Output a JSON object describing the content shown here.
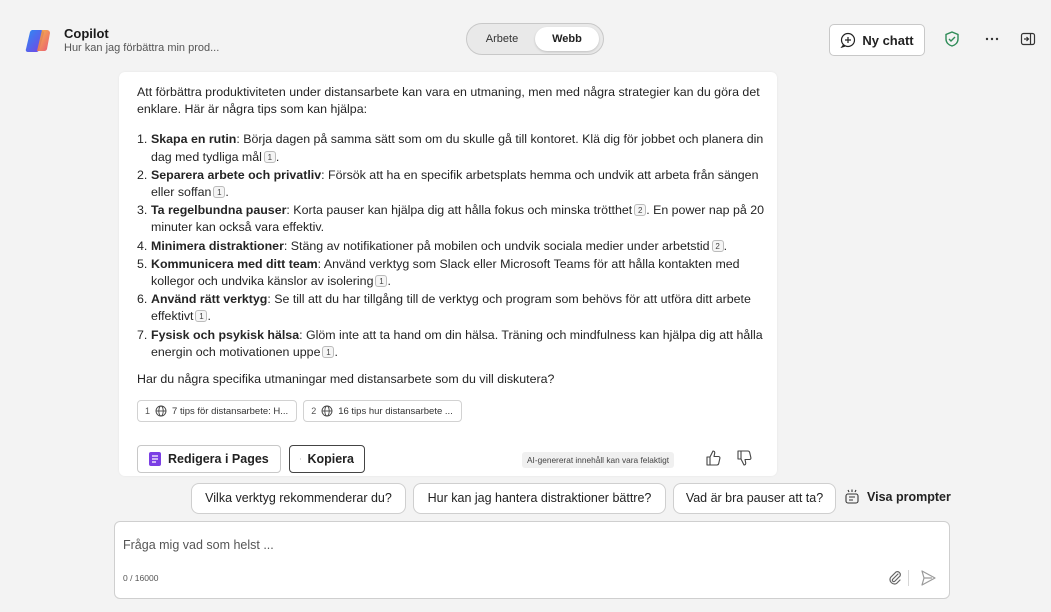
{
  "header": {
    "app_name": "Copilot",
    "subtitle": "Hur kan jag förbättra min prod...",
    "modes": [
      "Arbete",
      "Webb"
    ],
    "active_mode": "Webb",
    "new_chat_label": "Ny chatt"
  },
  "response": {
    "intro": "Att förbättra produktiviteten under distansarbete kan vara en utmaning, men med några strategier kan du göra det enklare. Här är några tips som kan hjälpa:",
    "tips": [
      {
        "num": "1.",
        "title": "Skapa en rutin",
        "text": ": Börja dagen på samma sätt som om du skulle gå till kontoret. Klä dig för jobbet och planera din dag med tydliga mål",
        "cite": "1",
        "end": "."
      },
      {
        "num": "2.",
        "title": "Separera arbete och privatliv",
        "text": ": Försök att ha en specifik arbetsplats hemma och undvik att arbeta från sängen eller soffan",
        "cite": "1",
        "end": "."
      },
      {
        "num": "3.",
        "title": "Ta regelbundna pauser",
        "text": ": Korta pauser kan hjälpa dig att hålla fokus och minska trötthet",
        "cite": "2",
        "end": ". En power nap på 20 minuter kan också vara effektiv."
      },
      {
        "num": "4.",
        "title": "Minimera distraktioner",
        "text": ": Stäng av notifikationer på mobilen och undvik sociala medier under arbetstid",
        "cite": "2",
        "end": "."
      },
      {
        "num": "5.",
        "title": "Kommunicera med ditt team",
        "text": ": Använd verktyg som Slack eller Microsoft Teams för att hålla kontakten med kollegor och undvika känslor av isolering",
        "cite": "1",
        "end": "."
      },
      {
        "num": "6.",
        "title": "Använd rätt verktyg",
        "text": ": Se till att du har tillgång till de verktyg och program som behövs för att utföra ditt arbete effektivt",
        "cite": "1",
        "end": "."
      },
      {
        "num": "7.",
        "title": "Fysisk och psykisk hälsa",
        "text": ": Glöm inte att ta hand om din hälsa. Träning och mindfulness kan hjälpa dig att hålla energin och motivationen uppe",
        "cite": "1",
        "end": "."
      }
    ],
    "followup": "Har du några specifika utmaningar med distansarbete som du vill diskutera?",
    "sources": [
      {
        "num": "1",
        "label": "7 tips för distansarbete: H..."
      },
      {
        "num": "2",
        "label": "16 tips hur distansarbete ..."
      }
    ],
    "edit_pages_label": "Redigera i Pages",
    "copy_label": "Kopiera",
    "disclaimer": "AI-genererat innehåll kan vara felaktigt"
  },
  "suggestions": {
    "chips": [
      "Vilka verktyg rekommenderar du?",
      "Hur kan jag hantera distraktioner bättre?",
      "Vad är bra pauser att ta?"
    ],
    "show_prompts_label": "Visa prompter"
  },
  "composer": {
    "placeholder": "Fråga mig vad som helst ...",
    "counter": "0 / 16000"
  },
  "colors": {
    "background": "#f3f3f3",
    "pages_icon": "#7b3fe4",
    "shield": "#2e8b57"
  }
}
